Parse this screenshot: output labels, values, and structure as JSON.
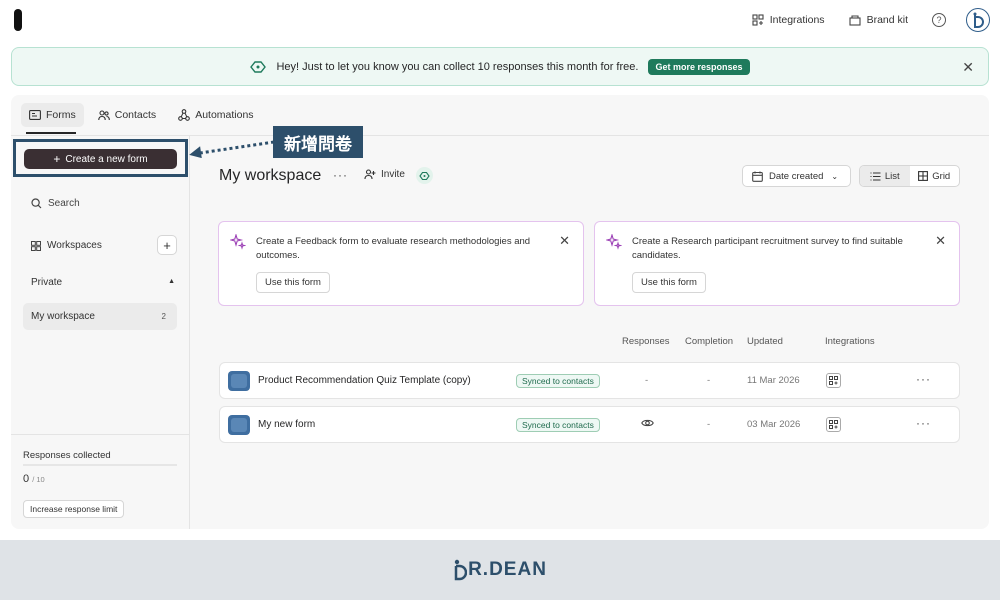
{
  "header": {
    "integrations_label": "Integrations",
    "brand_kit_label": "Brand kit",
    "help_glyph": "?"
  },
  "banner": {
    "message": "Hey! Just to let you know you can collect 10 responses this month for free.",
    "cta_label": "Get more responses",
    "close_glyph": "✕"
  },
  "tabs": [
    {
      "label": "Forms",
      "active": true
    },
    {
      "label": "Contacts",
      "active": false
    },
    {
      "label": "Automations",
      "active": false
    }
  ],
  "sidebar": {
    "create_label": "Create a new form",
    "search_label": "Search",
    "workspaces_label": "Workspaces",
    "private_label": "Private",
    "my_workspace_label": "My workspace",
    "my_workspace_count": "2",
    "responses_title": "Responses collected",
    "responses_count": "0",
    "responses_limit": "/ 10",
    "increase_label": "Increase response limit"
  },
  "annotation": {
    "label": "新增問卷"
  },
  "main": {
    "title": "My workspace",
    "invite_label": "Invite",
    "sort_label": "Date created",
    "view_list_label": "List",
    "view_grid_label": "Grid",
    "suggestions": [
      {
        "text": "Create a Feedback form to evaluate research methodologies and outcomes.",
        "button": "Use this form"
      },
      {
        "text": "Create a Research participant recruitment survey to find suitable candidates.",
        "button": "Use this form"
      }
    ],
    "columns": {
      "responses": "Responses",
      "completion": "Completion",
      "updated": "Updated",
      "integrations": "Integrations"
    },
    "forms": [
      {
        "name": "Product Recommendation Quiz Template (copy)",
        "badge": "Synced to contacts",
        "responses": "-",
        "completion": "-",
        "updated": "11 Mar 2026"
      },
      {
        "name": "My new form",
        "badge": "Synced to contacts",
        "responses": "",
        "completion": "-",
        "updated": "03 Mar 2026"
      }
    ]
  },
  "footer": {
    "brand_suffix": "R.DEAN"
  },
  "colors": {
    "accent_green": "#1f7a5c",
    "annotation_blue": "#2d4f6b",
    "create_button": "#3a2f33"
  }
}
